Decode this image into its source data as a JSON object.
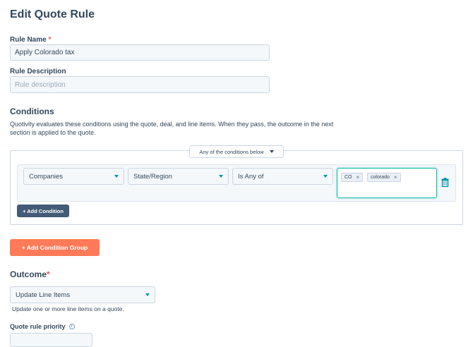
{
  "page": {
    "title": "Edit Quote Rule"
  },
  "rule_name": {
    "label": "Rule Name",
    "required_mark": "*",
    "value": "Apply Colorado tax"
  },
  "rule_description": {
    "label": "Rule Description",
    "placeholder": "Rule description"
  },
  "conditions": {
    "title": "Conditions",
    "description_line1": "Quotivity evaluates these conditions using the quote, deal, and line items. When they pass, the outcome in the next",
    "description_line2": "section is applied to the quote.",
    "logic_select": "Any of the conditions below",
    "row": {
      "object": "Companies",
      "property": "State/Region",
      "operator": "Is Any of",
      "tags": [
        {
          "label": "CO",
          "remove": "×"
        },
        {
          "label": "colorado",
          "remove": "×"
        }
      ]
    },
    "add_condition_label": "+ Add Condition",
    "add_group_label": "+ Add Condition Group"
  },
  "outcome": {
    "title": "Outcome",
    "required_mark": "*",
    "select": "Update Line Items",
    "help": "Update one or more line items on a quote."
  },
  "priority": {
    "label": "Quote rule priority",
    "info_glyph": "i"
  },
  "icons": {
    "delete": "trash-icon",
    "dropdown": "caret-down-icon",
    "info": "info-icon"
  },
  "colors": {
    "accent": "#0091ae",
    "primary_button": "#ff7a59",
    "secondary_button": "#425b76",
    "text": "#33475b"
  }
}
